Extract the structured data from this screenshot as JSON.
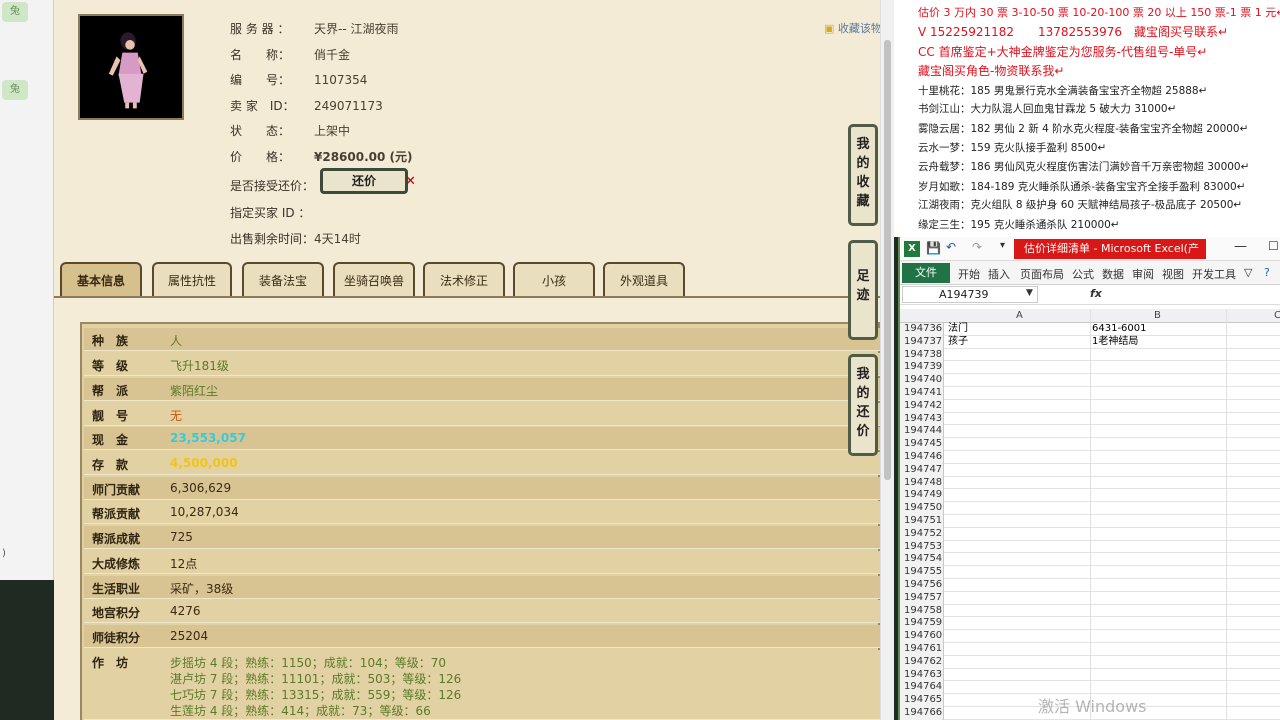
{
  "left_strip": {
    "icon_labels": [
      "兔",
      "兔"
    ],
    "row_label": ")"
  },
  "game": {
    "favorite_link": "收藏该物",
    "info": [
      {
        "key": "服 务 器 ：",
        "value": "天界-- 江湖夜雨"
      },
      {
        "key": "名　　称：",
        "value": "俏千金"
      },
      {
        "key": "编　　号：",
        "value": "1107354"
      },
      {
        "key": "卖 家　ID：",
        "value": "249071173"
      },
      {
        "key": "状　　态：",
        "value": "上架中"
      },
      {
        "key": "价　　格：",
        "value": "¥28600.00 (元)"
      },
      {
        "key": "是否接受还价：",
        "value": ""
      },
      {
        "key": "指定买家 ID ：",
        "value": ""
      },
      {
        "key": "出售剩余时间：",
        "value": "4天14时"
      }
    ],
    "bargain_button": "还价",
    "tabs": [
      "基本信息",
      "属性抗性",
      "装备法宝",
      "坐骑召唤兽",
      "法术修正",
      "小孩",
      "外观道具"
    ],
    "side_buttons": [
      "我的收藏",
      "足迹",
      "我的还价"
    ],
    "attributes": [
      {
        "key": "种　族",
        "value": "人",
        "style": "green"
      },
      {
        "key": "等　级",
        "value": "飞升181级",
        "style": "green"
      },
      {
        "key": "帮　派",
        "value": "紫陌红尘",
        "style": "green"
      },
      {
        "key": "靓　号",
        "value": "无",
        "style": "orange"
      },
      {
        "key": "现　金",
        "value": "23,553,057",
        "style": "cyan"
      },
      {
        "key": "存　款",
        "value": "4,500,000",
        "style": "yellow"
      },
      {
        "key": "师门贡献",
        "value": "6,306,629",
        "style": "dark"
      },
      {
        "key": "帮派贡献",
        "value": "10,287,034",
        "style": "dark"
      },
      {
        "key": "帮派成就",
        "value": "725",
        "style": "dark"
      },
      {
        "key": "大成修炼",
        "value": "12点",
        "style": "dark"
      },
      {
        "key": "生活职业",
        "value": "采矿，38级",
        "style": "dark"
      },
      {
        "key": "地宫积分",
        "value": "4276",
        "style": "dark"
      },
      {
        "key": "师徒积分",
        "value": "25204",
        "style": "dark"
      }
    ],
    "workshop_label": "作　坊",
    "workshops": [
      "步摇坊 4 段；熟练：1150；成就：104；等级：70",
      "湛卢坊 7 段；熟练：11101；成就：503；等级：126",
      "七巧坊 7 段；熟练：13315；成就：559；等级：126",
      "生莲坊 4 段；熟练：414；成就：73；等级：66"
    ]
  },
  "notes": {
    "red": [
      "估价 3 万内 30 票 3-10-50 票 10-20-100 票 20 以上 150 票-1 票 1 元↵",
      "V 15225921182　　13782553976　藏宝阁买号联系↵",
      "CC 首席鉴定+大神金牌鉴定为您服务-代售组号-单号↵",
      "藏宝阁买角色-物资联系我↵"
    ],
    "black": [
      "十里桃花：185 男鬼景行克水全满装备宝宝齐全物超 25888↵",
      "书剑江山：大力队混人回血鬼甘霖龙 5 破大力 31000↵",
      "雾隐云居：182 男仙 2 新 4 阶水克火程度-装备宝宝齐全物超 20000↵",
      "云水一梦：159 克火队接手盈利 8500↵",
      "云舟载梦：186 男仙风克火程度伤害法门满妙音千万亲密物超 30000↵",
      "岁月如歌：184-189 克火睡杀队通杀-装备宝宝齐全接手盈利 83000↵",
      "江湖夜雨：克火组队 8 级护身 60 天赋神结局孩子-极品底子 20500↵",
      "缘定三生：195 克火睡杀通杀队 210000↵"
    ]
  },
  "excel": {
    "title": "估价详细清单 - Microsoft Excel(产",
    "logo": "X",
    "file_tab": "文件",
    "ribbon_tabs": [
      "开始",
      "插入",
      "页面布局",
      "公式",
      "数据",
      "审阅",
      "视图",
      "开发工具"
    ],
    "name_box": "A194739",
    "fx": "fx",
    "columns": [
      "A",
      "B",
      "C"
    ],
    "rows": [
      {
        "n": "194736",
        "a": "法门",
        "b": "6431-6001"
      },
      {
        "n": "194737",
        "a": "孩子",
        "b": "1老神结局"
      },
      {
        "n": "194738",
        "a": "",
        "b": ""
      },
      {
        "n": "194739",
        "a": "",
        "b": ""
      },
      {
        "n": "194740",
        "a": "",
        "b": ""
      },
      {
        "n": "194741",
        "a": "",
        "b": ""
      },
      {
        "n": "194742",
        "a": "",
        "b": ""
      },
      {
        "n": "194743",
        "a": "",
        "b": ""
      },
      {
        "n": "194744",
        "a": "",
        "b": ""
      },
      {
        "n": "194745",
        "a": "",
        "b": ""
      },
      {
        "n": "194746",
        "a": "",
        "b": ""
      },
      {
        "n": "194747",
        "a": "",
        "b": ""
      },
      {
        "n": "194748",
        "a": "",
        "b": ""
      },
      {
        "n": "194749",
        "a": "",
        "b": ""
      },
      {
        "n": "194750",
        "a": "",
        "b": ""
      },
      {
        "n": "194751",
        "a": "",
        "b": ""
      },
      {
        "n": "194752",
        "a": "",
        "b": ""
      },
      {
        "n": "194753",
        "a": "",
        "b": ""
      },
      {
        "n": "194754",
        "a": "",
        "b": ""
      },
      {
        "n": "194755",
        "a": "",
        "b": ""
      },
      {
        "n": "194756",
        "a": "",
        "b": ""
      },
      {
        "n": "194757",
        "a": "",
        "b": ""
      },
      {
        "n": "194758",
        "a": "",
        "b": ""
      },
      {
        "n": "194759",
        "a": "",
        "b": ""
      },
      {
        "n": "194760",
        "a": "",
        "b": ""
      },
      {
        "n": "194761",
        "a": "",
        "b": ""
      },
      {
        "n": "194762",
        "a": "",
        "b": ""
      },
      {
        "n": "194763",
        "a": "",
        "b": ""
      },
      {
        "n": "194764",
        "a": "",
        "b": ""
      },
      {
        "n": "194765",
        "a": "",
        "b": ""
      },
      {
        "n": "194766",
        "a": "",
        "b": ""
      }
    ],
    "watermark": "激活 Windows"
  }
}
